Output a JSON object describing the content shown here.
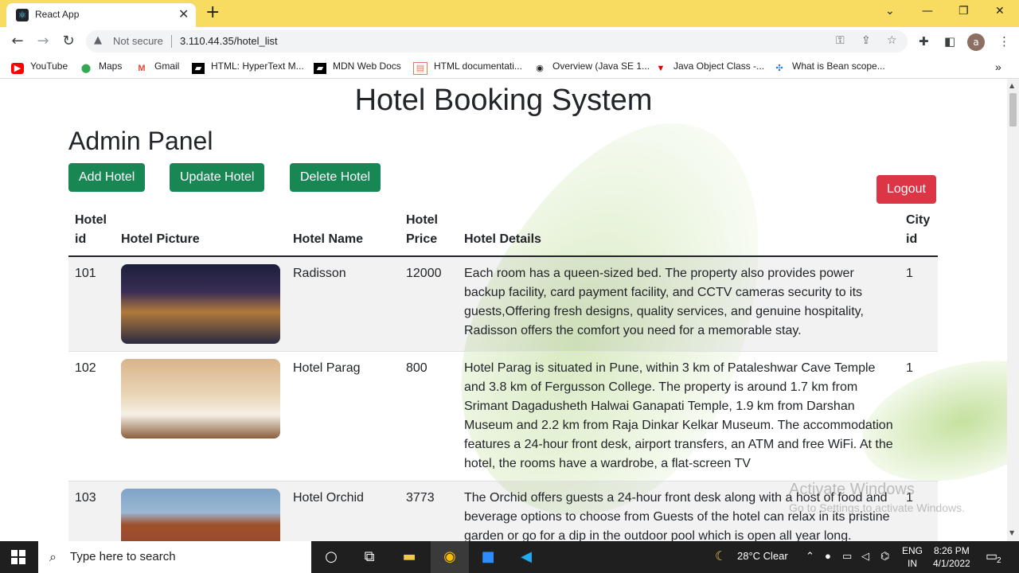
{
  "browser": {
    "tab_title": "React App",
    "security_label": "Not secure",
    "url": "3.110.44.35/hotel_list",
    "bookmarks": [
      {
        "label": "YouTube",
        "icon": "youtube-icon"
      },
      {
        "label": "Maps",
        "icon": "maps-icon"
      },
      {
        "label": "Gmail",
        "icon": "gmail-icon"
      },
      {
        "label": "HTML: HyperText M...",
        "icon": "mdn-icon"
      },
      {
        "label": "MDN Web Docs",
        "icon": "mdn-icon"
      },
      {
        "label": "HTML documentati...",
        "icon": "doc-icon"
      },
      {
        "label": "Overview (Java SE 1...",
        "icon": "java-icon"
      },
      {
        "label": "Java Object Class -...",
        "icon": "javatpoint-icon"
      },
      {
        "label": "What is Bean scope...",
        "icon": "spring-icon"
      }
    ],
    "avatar_letter": "a"
  },
  "page": {
    "title": "Hotel Booking System",
    "subtitle": "Admin Panel",
    "buttons": {
      "add": "Add Hotel",
      "update": "Update Hotel",
      "delete": "Delete Hotel",
      "logout": "Logout"
    },
    "table": {
      "headers": {
        "id_line1": "Hotel",
        "id_line2": "id",
        "picture": "Hotel Picture",
        "name": "Hotel Name",
        "price_line1": "Hotel",
        "price_line2": "Price",
        "details": "Hotel Details",
        "city_line1": "City",
        "city_line2": "id"
      },
      "rows": [
        {
          "id": "101",
          "name": "Radisson",
          "price": "12000",
          "details": "Each room has a queen-sized bed. The property also provides power backup facility, card payment facility, and CCTV cameras security to its guests,Offering fresh designs, quality services, and genuine hospitality, Radisson offers the comfort you need for a memorable stay.",
          "city_id": "1"
        },
        {
          "id": "102",
          "name": "Hotel Parag",
          "price": "800",
          "details": "Hotel Parag is situated in Pune, within 3 km of Pataleshwar Cave Temple and 3.8 km of Fergusson College. The property is around 1.7 km from Srimant Dagadusheth Halwai Ganapati Temple, 1.9 km from Darshan Museum and 2.2 km from Raja Dinkar Kelkar Museum. The accommodation features a 24-hour front desk, airport transfers, an ATM and free WiFi. At the hotel, the rooms have a wardrobe, a flat-screen TV",
          "city_id": "1"
        },
        {
          "id": "103",
          "name": "Hotel Orchid",
          "price": "3773",
          "details": "The Orchid offers guests a 24-hour front desk along with a host of food and beverage options to choose from Guests of the hotel can relax in its pristine garden or go for a dip in the outdoor pool which is open all year long.",
          "city_id": "1"
        }
      ]
    },
    "watermark": {
      "line1": "Activate Windows",
      "line2": "Go to Settings to activate Windows."
    }
  },
  "taskbar": {
    "search_placeholder": "Type here to search",
    "weather": "28°C  Clear",
    "language_line1": "ENG",
    "language_line2": "IN",
    "time": "8:26 PM",
    "date": "4/1/2022",
    "notification_count": "2"
  }
}
